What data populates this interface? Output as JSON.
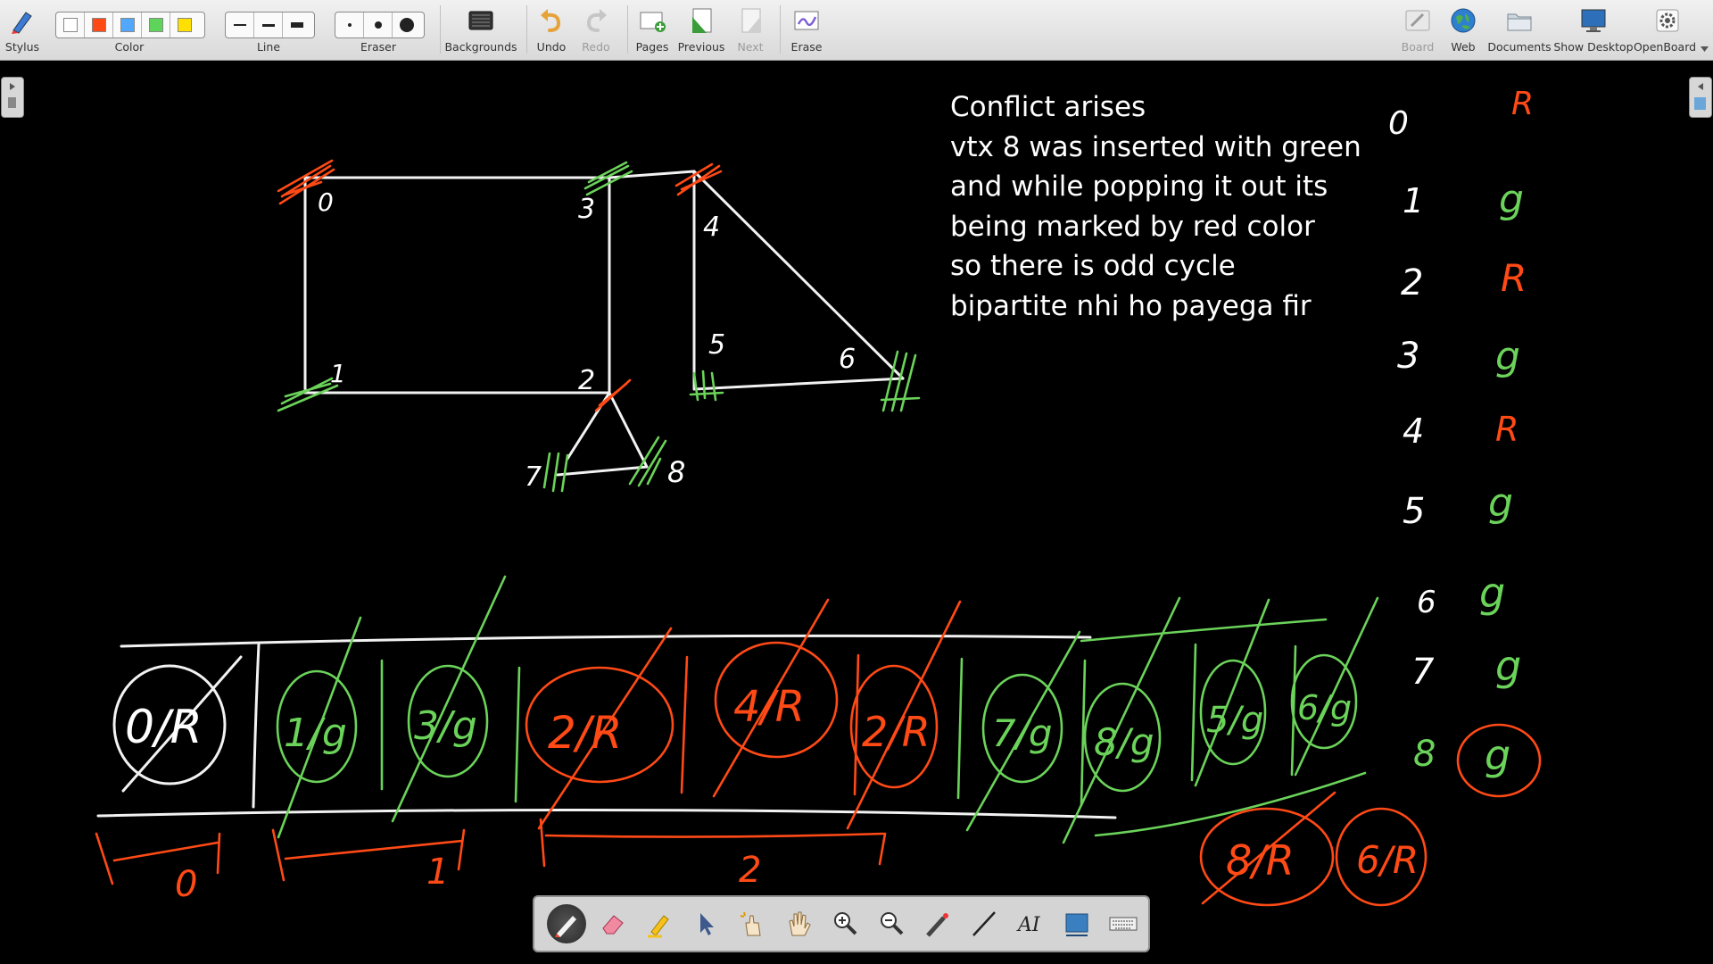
{
  "toolbar": {
    "stylus": "Stylus",
    "color": "Color",
    "line": "Line",
    "eraser": "Eraser",
    "backgrounds": "Backgrounds",
    "undo": "Undo",
    "redo": "Redo",
    "pages": "Pages",
    "previous": "Previous",
    "next": "Next",
    "erase": "Erase",
    "board": "Board",
    "web": "Web",
    "documents": "Documents",
    "show_desktop": "Show Desktop",
    "openboard": "OpenBoard",
    "colors": [
      "#ffffff",
      "#ff4a16",
      "#52a8ff",
      "#5fd45a",
      "#ffe000"
    ]
  },
  "note": {
    "lines": [
      "Conflict arises",
      "vtx 8 was inserted with green",
      "and while popping it out its",
      "being marked by red color",
      "so there is odd cycle",
      "bipartite nhi ho payega fir"
    ]
  },
  "graph": {
    "vertex_labels": [
      "0",
      "1",
      "2",
      "3",
      "4",
      "5",
      "6",
      "7",
      "8"
    ]
  },
  "color_table": {
    "vertices": [
      "0",
      "1",
      "2",
      "3",
      "4",
      "5",
      "6",
      "7",
      "8"
    ],
    "colors": [
      "R",
      "g",
      "R",
      "g",
      "R",
      "g",
      "g",
      "g",
      "g"
    ]
  },
  "queue": {
    "cells": [
      "0/R",
      "1/g",
      "3/g",
      "2/R",
      "4/R",
      "2/R",
      "7/g",
      "8/g",
      "5/g",
      "6/g"
    ],
    "extra": [
      "8/R",
      "6/R"
    ],
    "levels": [
      "0",
      "1",
      "2"
    ]
  },
  "float_tools": [
    "pen",
    "eraser",
    "highlighter",
    "selector",
    "interactor",
    "hand",
    "zoom-in",
    "zoom-out",
    "laser",
    "line",
    "text",
    "capture",
    "keyboard"
  ]
}
